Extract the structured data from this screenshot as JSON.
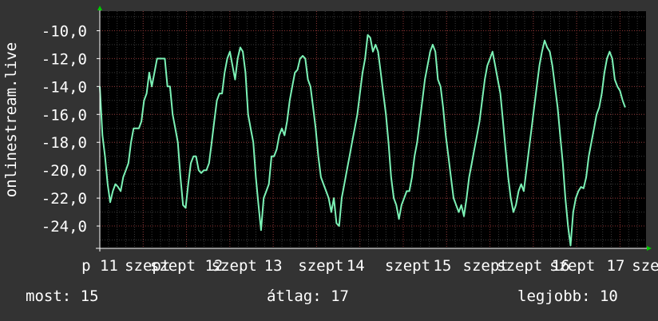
{
  "chart_data": {
    "type": "line",
    "title": "",
    "ylabel": "onlinestream.live",
    "xlabel": "",
    "ylim": [
      -25.6,
      -8.6
    ],
    "y_ticks": [
      -10,
      -12,
      -14,
      -16,
      -18,
      -20,
      -22,
      -24
    ],
    "y_tick_labels": [
      "-10,0",
      "-12,0",
      "-14,0",
      "-16,0",
      "-18,0",
      "-20,0",
      "-22,0",
      "-24,0"
    ],
    "x_range": [
      0,
      6.3
    ],
    "x_ticks": [
      {
        "x": 0.0,
        "label": "p 11"
      },
      {
        "x": 0.55,
        "label": "szept"
      },
      {
        "x": 1.0,
        "label": "szept 12"
      },
      {
        "x": 1.55,
        "label": "szept"
      },
      {
        "x": 2.0,
        "label": "13"
      },
      {
        "x": 2.55,
        "label": "szept"
      },
      {
        "x": 2.95,
        "label": "14"
      },
      {
        "x": 3.55,
        "label": "szept"
      },
      {
        "x": 3.95,
        "label": "15"
      },
      {
        "x": 4.45,
        "label": "szept"
      },
      {
        "x": 5.0,
        "label": "szept 16"
      },
      {
        "x": 5.45,
        "label": "szept"
      },
      {
        "x": 5.95,
        "label": "17"
      },
      {
        "x": 6.4,
        "label": "szept"
      }
    ],
    "grid": true,
    "series": [
      {
        "color": "#7cf2b6",
        "points": [
          [
            0.0,
            -14.0
          ],
          [
            0.03,
            -17.5
          ],
          [
            0.06,
            -19.0
          ],
          [
            0.09,
            -21.0
          ],
          [
            0.12,
            -22.3
          ],
          [
            0.15,
            -21.5
          ],
          [
            0.18,
            -21.0
          ],
          [
            0.21,
            -21.2
          ],
          [
            0.24,
            -21.5
          ],
          [
            0.27,
            -20.5
          ],
          [
            0.3,
            -20.0
          ],
          [
            0.33,
            -19.5
          ],
          [
            0.36,
            -18.0
          ],
          [
            0.39,
            -17.0
          ],
          [
            0.42,
            -17.0
          ],
          [
            0.45,
            -17.0
          ],
          [
            0.48,
            -16.5
          ],
          [
            0.51,
            -15.0
          ],
          [
            0.54,
            -14.5
          ],
          [
            0.57,
            -13.0
          ],
          [
            0.6,
            -14.0
          ],
          [
            0.63,
            -13.0
          ],
          [
            0.66,
            -12.0
          ],
          [
            0.69,
            -12.0
          ],
          [
            0.72,
            -12.0
          ],
          [
            0.75,
            -12.0
          ],
          [
            0.78,
            -14.0
          ],
          [
            0.81,
            -14.0
          ],
          [
            0.84,
            -16.0
          ],
          [
            0.87,
            -17.0
          ],
          [
            0.9,
            -18.0
          ],
          [
            0.93,
            -20.5
          ],
          [
            0.96,
            -22.5
          ],
          [
            0.99,
            -22.7
          ],
          [
            1.02,
            -21.0
          ],
          [
            1.05,
            -19.5
          ],
          [
            1.08,
            -19.0
          ],
          [
            1.11,
            -19.0
          ],
          [
            1.14,
            -20.0
          ],
          [
            1.17,
            -20.2
          ],
          [
            1.2,
            -20.0
          ],
          [
            1.23,
            -20.0
          ],
          [
            1.26,
            -19.5
          ],
          [
            1.29,
            -18.0
          ],
          [
            1.32,
            -16.5
          ],
          [
            1.35,
            -15.0
          ],
          [
            1.38,
            -14.5
          ],
          [
            1.41,
            -14.5
          ],
          [
            1.44,
            -13.0
          ],
          [
            1.47,
            -12.0
          ],
          [
            1.5,
            -11.5
          ],
          [
            1.53,
            -12.5
          ],
          [
            1.56,
            -13.5
          ],
          [
            1.59,
            -12.0
          ],
          [
            1.62,
            -11.2
          ],
          [
            1.65,
            -11.5
          ],
          [
            1.68,
            -13.0
          ],
          [
            1.71,
            -16.0
          ],
          [
            1.74,
            -17.0
          ],
          [
            1.77,
            -18.0
          ],
          [
            1.8,
            -20.5
          ],
          [
            1.83,
            -22.5
          ],
          [
            1.86,
            -24.3
          ],
          [
            1.89,
            -22.0
          ],
          [
            1.92,
            -21.5
          ],
          [
            1.95,
            -21.0
          ],
          [
            1.98,
            -19.0
          ],
          [
            2.01,
            -19.0
          ],
          [
            2.04,
            -18.5
          ],
          [
            2.07,
            -17.5
          ],
          [
            2.1,
            -17.0
          ],
          [
            2.13,
            -17.5
          ],
          [
            2.16,
            -16.5
          ],
          [
            2.19,
            -15.0
          ],
          [
            2.22,
            -14.0
          ],
          [
            2.25,
            -13.0
          ],
          [
            2.28,
            -12.8
          ],
          [
            2.31,
            -12.0
          ],
          [
            2.34,
            -11.8
          ],
          [
            2.37,
            -12.0
          ],
          [
            2.4,
            -13.5
          ],
          [
            2.43,
            -14.0
          ],
          [
            2.46,
            -15.5
          ],
          [
            2.49,
            -17.0
          ],
          [
            2.52,
            -19.0
          ],
          [
            2.55,
            -20.5
          ],
          [
            2.58,
            -21.0
          ],
          [
            2.61,
            -21.5
          ],
          [
            2.64,
            -22.0
          ],
          [
            2.67,
            -23.0
          ],
          [
            2.7,
            -22.0
          ],
          [
            2.73,
            -23.8
          ],
          [
            2.76,
            -24.0
          ],
          [
            2.79,
            -22.0
          ],
          [
            2.82,
            -21.0
          ],
          [
            2.85,
            -20.0
          ],
          [
            2.88,
            -19.0
          ],
          [
            2.91,
            -18.0
          ],
          [
            2.94,
            -17.0
          ],
          [
            2.97,
            -16.0
          ],
          [
            3.0,
            -14.5
          ],
          [
            3.03,
            -13.0
          ],
          [
            3.06,
            -12.0
          ],
          [
            3.09,
            -10.3
          ],
          [
            3.12,
            -10.5
          ],
          [
            3.15,
            -11.5
          ],
          [
            3.18,
            -11.0
          ],
          [
            3.21,
            -11.5
          ],
          [
            3.24,
            -13.0
          ],
          [
            3.27,
            -14.5
          ],
          [
            3.3,
            -16.0
          ],
          [
            3.33,
            -18.0
          ],
          [
            3.36,
            -20.5
          ],
          [
            3.39,
            -22.0
          ],
          [
            3.42,
            -22.5
          ],
          [
            3.45,
            -23.5
          ],
          [
            3.48,
            -22.5
          ],
          [
            3.51,
            -22.0
          ],
          [
            3.54,
            -21.5
          ],
          [
            3.57,
            -21.5
          ],
          [
            3.6,
            -20.5
          ],
          [
            3.63,
            -19.0
          ],
          [
            3.66,
            -18.0
          ],
          [
            3.69,
            -16.5
          ],
          [
            3.72,
            -15.0
          ],
          [
            3.75,
            -13.5
          ],
          [
            3.78,
            -12.5
          ],
          [
            3.81,
            -11.5
          ],
          [
            3.84,
            -11.0
          ],
          [
            3.87,
            -11.5
          ],
          [
            3.9,
            -13.5
          ],
          [
            3.93,
            -14.0
          ],
          [
            3.96,
            -15.5
          ],
          [
            3.99,
            -17.5
          ],
          [
            4.02,
            -19.0
          ],
          [
            4.05,
            -20.5
          ],
          [
            4.08,
            -22.0
          ],
          [
            4.11,
            -22.5
          ],
          [
            4.14,
            -23.0
          ],
          [
            4.17,
            -22.5
          ],
          [
            4.2,
            -23.3
          ],
          [
            4.23,
            -22.0
          ],
          [
            4.26,
            -20.5
          ],
          [
            4.29,
            -19.5
          ],
          [
            4.32,
            -18.5
          ],
          [
            4.35,
            -17.5
          ],
          [
            4.38,
            -16.5
          ],
          [
            4.41,
            -15.0
          ],
          [
            4.44,
            -13.5
          ],
          [
            4.47,
            -12.5
          ],
          [
            4.5,
            -12.0
          ],
          [
            4.53,
            -11.5
          ],
          [
            4.56,
            -12.5
          ],
          [
            4.59,
            -13.5
          ],
          [
            4.62,
            -14.5
          ],
          [
            4.65,
            -16.5
          ],
          [
            4.68,
            -18.5
          ],
          [
            4.71,
            -20.5
          ],
          [
            4.74,
            -22.0
          ],
          [
            4.77,
            -23.0
          ],
          [
            4.8,
            -22.5
          ],
          [
            4.83,
            -21.5
          ],
          [
            4.86,
            -21.0
          ],
          [
            4.89,
            -21.5
          ],
          [
            4.92,
            -20.0
          ],
          [
            4.95,
            -18.5
          ],
          [
            4.98,
            -17.0
          ],
          [
            5.01,
            -15.5
          ],
          [
            5.04,
            -14.0
          ],
          [
            5.07,
            -12.5
          ],
          [
            5.1,
            -11.5
          ],
          [
            5.13,
            -10.7
          ],
          [
            5.16,
            -11.2
          ],
          [
            5.19,
            -11.5
          ],
          [
            5.22,
            -12.5
          ],
          [
            5.25,
            -14.0
          ],
          [
            5.28,
            -15.5
          ],
          [
            5.31,
            -17.5
          ],
          [
            5.34,
            -19.5
          ],
          [
            5.37,
            -22.0
          ],
          [
            5.4,
            -24.0
          ],
          [
            5.43,
            -25.4
          ],
          [
            5.46,
            -23.0
          ],
          [
            5.49,
            -22.0
          ],
          [
            5.52,
            -21.5
          ],
          [
            5.55,
            -21.2
          ],
          [
            5.58,
            -21.3
          ],
          [
            5.61,
            -20.5
          ],
          [
            5.64,
            -19.0
          ],
          [
            5.67,
            -18.0
          ],
          [
            5.7,
            -17.0
          ],
          [
            5.73,
            -16.0
          ],
          [
            5.76,
            -15.5
          ],
          [
            5.79,
            -14.5
          ],
          [
            5.82,
            -13.0
          ],
          [
            5.85,
            -12.0
          ],
          [
            5.88,
            -11.5
          ],
          [
            5.91,
            -12.0
          ],
          [
            5.94,
            -13.5
          ],
          [
            5.97,
            -14.0
          ],
          [
            6.0,
            -14.3
          ],
          [
            6.03,
            -15.0
          ],
          [
            6.06,
            -15.5
          ]
        ]
      }
    ]
  },
  "footer": {
    "now": "most: 15",
    "avg": "átlag: 17",
    "best": "legjobb: 10"
  }
}
